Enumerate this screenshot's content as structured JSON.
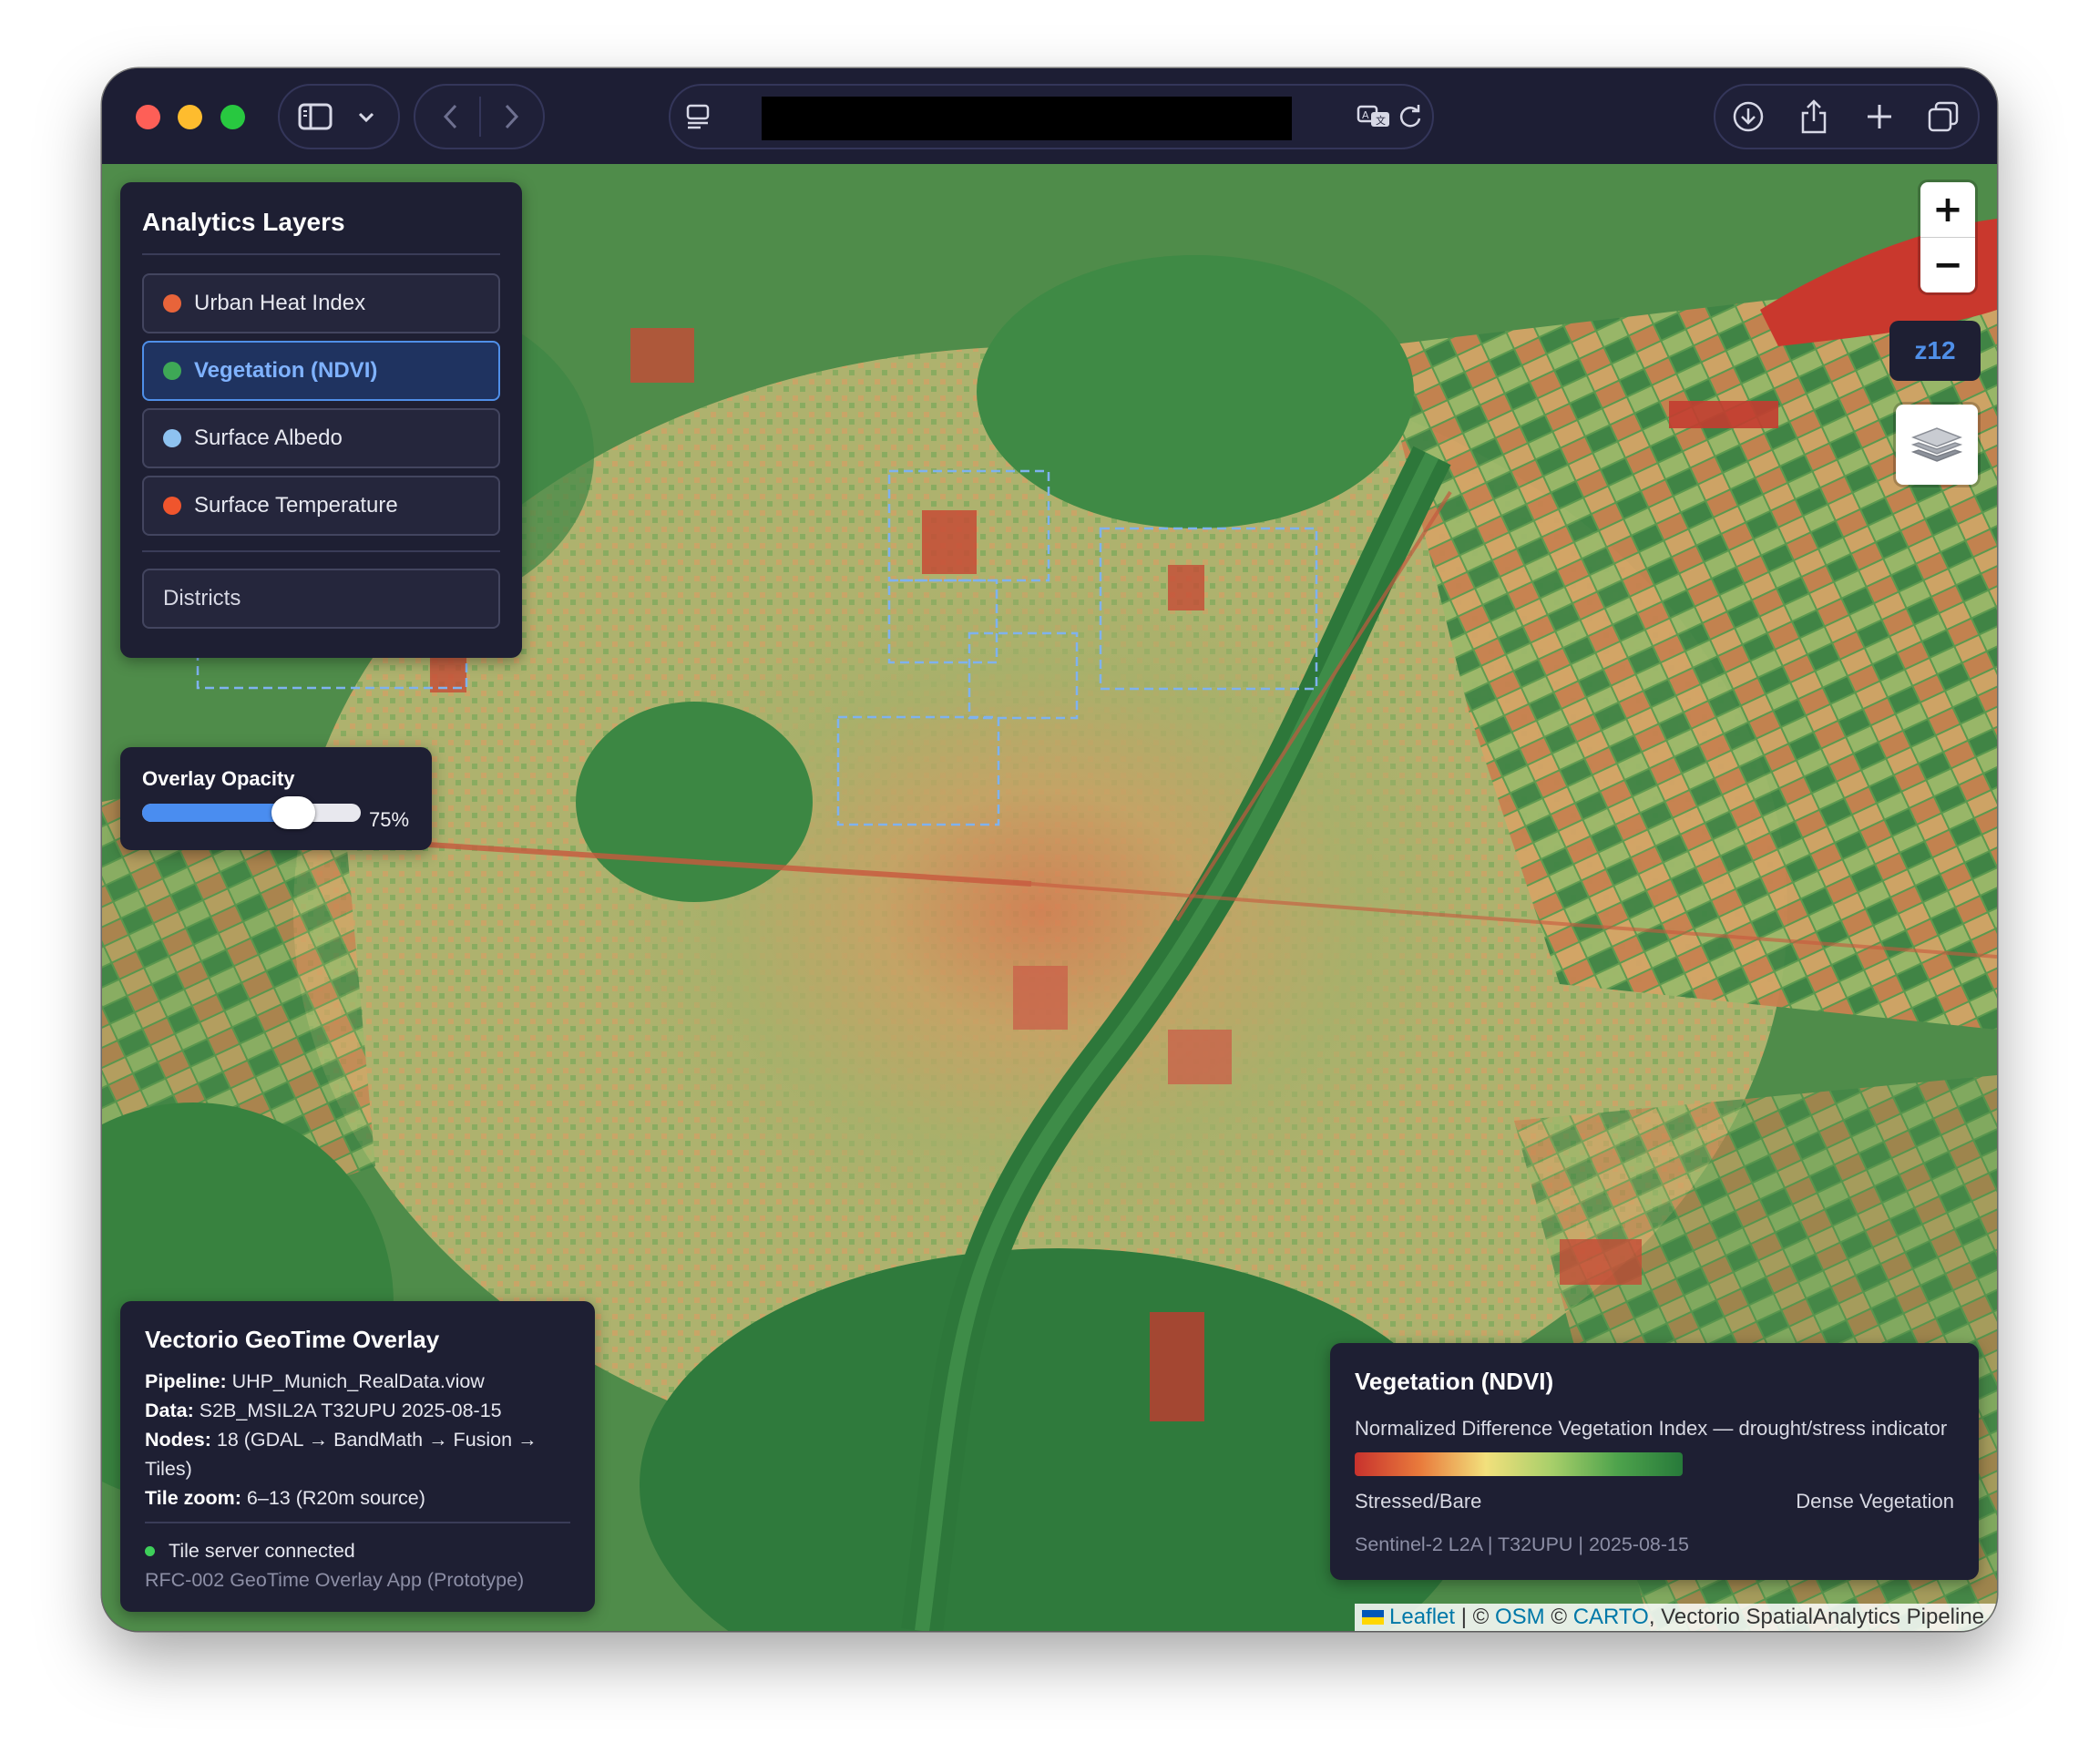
{
  "browser": {
    "url_redacted": true
  },
  "map": {
    "zoom_in_label": "+",
    "zoom_out_label": "−",
    "zoom_badge": "z12",
    "layer_switch_icon": "layers-icon"
  },
  "layers_panel": {
    "title": "Analytics Layers",
    "items": [
      {
        "label": "Urban Heat Index",
        "color": "#e8643a",
        "active": false
      },
      {
        "label": "Vegetation (NDVI)",
        "color": "#3ea856",
        "active": true
      },
      {
        "label": "Surface Albedo",
        "color": "#8ec2f0",
        "active": false
      },
      {
        "label": "Surface Temperature",
        "color": "#f0552d",
        "active": false
      }
    ],
    "districts_label": "Districts"
  },
  "opacity_panel": {
    "title": "Overlay Opacity",
    "value": 0.75,
    "value_label": "75%"
  },
  "info_panel": {
    "title": "Vectorio GeoTime Overlay",
    "pipeline_label": "Pipeline:",
    "pipeline_value": "UHP_Munich_RealData.viow",
    "data_label": "Data:",
    "data_value": "S2B_MSIL2A T32UPU 2025-08-15",
    "nodes_label": "Nodes:",
    "nodes_value": "18 (GDAL → BandMath → Fusion → Tiles)",
    "tilezoom_label": "Tile zoom:",
    "tilezoom_value": "6–13 (R20m source)",
    "status": "Tile server connected",
    "status_color": "#3ecf5a",
    "footer": "RFC-002 GeoTime Overlay App (Prototype)"
  },
  "legend": {
    "title": "Vegetation (NDVI)",
    "description": "Normalized Difference Vegetation Index — drought/stress indicator",
    "low_label": "Stressed/Bare",
    "high_label": "Dense Vegetation",
    "source": "Sentinel-2 L2A | T32UPU | 2025-08-15",
    "gradient_colors": [
      "#c8322d",
      "#e97b3c",
      "#f2e07c",
      "#a8cf6a",
      "#4ea34c",
      "#277a3a"
    ]
  },
  "attribution": {
    "leaflet": "Leaflet",
    "sep1": " | © ",
    "osm": "OSM",
    "sep2": " © ",
    "carto": "CARTO",
    "rest": ", Vectorio SpatialAnalytics Pipeline"
  }
}
